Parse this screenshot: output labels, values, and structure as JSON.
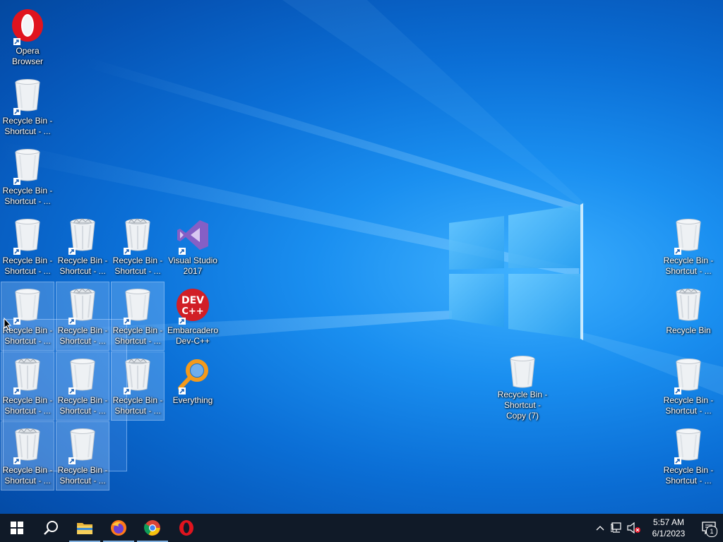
{
  "desktop": {
    "icons": [
      {
        "label": "Opera\nBrowser",
        "type": "opera",
        "shortcut": true,
        "selected": false
      },
      {
        "label": "Recycle Bin -\nShortcut - ...",
        "type": "bin-empty",
        "shortcut": true,
        "selected": false
      },
      {
        "label": "Recycle Bin -\nShortcut - ...",
        "type": "bin-empty",
        "shortcut": true,
        "selected": false
      },
      {
        "label": "Recycle Bin -\nShortcut - ...",
        "type": "bin-empty",
        "shortcut": true,
        "selected": false
      },
      {
        "label": "Recycle Bin -\nShortcut - ...",
        "type": "bin-full",
        "shortcut": true,
        "selected": false
      },
      {
        "label": "Recycle Bin -\nShortcut - ...",
        "type": "bin-full",
        "shortcut": true,
        "selected": false
      },
      {
        "label": "Visual Studio\n2017",
        "type": "vs",
        "shortcut": true,
        "selected": false
      },
      {
        "label": "Recycle Bin -\nShortcut - ...",
        "type": "bin-empty",
        "shortcut": true,
        "selected": true
      },
      {
        "label": "Recycle Bin -\nShortcut - ...",
        "type": "bin-full",
        "shortcut": true,
        "selected": true
      },
      {
        "label": "Recycle Bin -\nShortcut - ...",
        "type": "bin-empty",
        "shortcut": true,
        "selected": true
      },
      {
        "label": "Embarcadero\nDev-C++",
        "type": "devcpp",
        "shortcut": true,
        "selected": false
      },
      {
        "label": "Recycle Bin -\nShortcut - ...",
        "type": "bin-full",
        "shortcut": true,
        "selected": true
      },
      {
        "label": "Recycle Bin -\nShortcut - ...",
        "type": "bin-empty",
        "shortcut": true,
        "selected": true
      },
      {
        "label": "Recycle Bin -\nShortcut - ...",
        "type": "bin-full",
        "shortcut": true,
        "selected": true
      },
      {
        "label": "Everything",
        "type": "everything",
        "shortcut": true,
        "selected": false
      },
      {
        "label": "Recycle Bin -\nShortcut - ...",
        "type": "bin-full",
        "shortcut": true,
        "selected": true
      },
      {
        "label": "Recycle Bin -\nShortcut - ...",
        "type": "bin-empty",
        "shortcut": true,
        "selected": true
      },
      {
        "label": "Recycle Bin -\nShortcut -\nCopy (7)",
        "type": "bin-empty",
        "shortcut": false,
        "selected": false
      },
      {
        "label": "Recycle Bin -\nShortcut - ...",
        "type": "bin-empty",
        "shortcut": true,
        "selected": false
      },
      {
        "label": "Recycle Bin",
        "type": "bin-full",
        "shortcut": false,
        "selected": false
      },
      {
        "label": "Recycle Bin -\nShortcut - ...",
        "type": "bin-empty",
        "shortcut": true,
        "selected": false
      },
      {
        "label": "Recycle Bin -\nShortcut - ...",
        "type": "bin-empty",
        "shortcut": true,
        "selected": false
      }
    ]
  },
  "taskbar": {
    "buttons": [
      {
        "name": "start-button",
        "icon": "windows-logo-icon",
        "running": false
      },
      {
        "name": "search-button",
        "icon": "search-icon",
        "running": false
      },
      {
        "name": "file-explorer-button",
        "icon": "folder-icon",
        "running": true
      },
      {
        "name": "firefox-button",
        "icon": "firefox-icon",
        "running": true
      },
      {
        "name": "chrome-button",
        "icon": "chrome-icon",
        "running": true
      },
      {
        "name": "opera-button",
        "icon": "opera-icon",
        "running": false
      }
    ],
    "tray": {
      "time": "5:57 AM",
      "date": "6/1/2023",
      "notification_count": "1"
    }
  },
  "colors": {
    "taskbar": "#101a28",
    "opera_red": "#e0141e",
    "vs_purple": "#865fc5",
    "devcpp_red": "#d11f26",
    "everything_orange": "#f39a1c"
  }
}
